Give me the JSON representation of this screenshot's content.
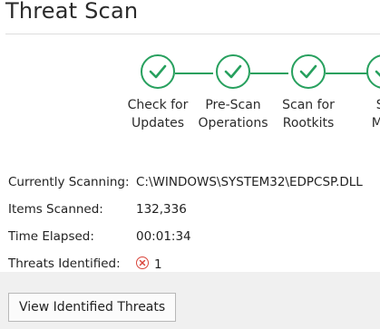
{
  "header": {
    "title": "Threat Scan"
  },
  "stepper": {
    "steps": [
      {
        "label": "Check for\nUpdates",
        "state": "complete",
        "icon": "check-icon"
      },
      {
        "label": "Pre-Scan\nOperations",
        "state": "complete",
        "icon": "check-icon"
      },
      {
        "label": "Scan for\nRootkits",
        "state": "complete",
        "icon": "check-icon"
      },
      {
        "label": "Sc\nMer",
        "state": "complete",
        "icon": "check-icon"
      }
    ],
    "color": "#27a05e"
  },
  "details": {
    "currently_scanning_label": "Currently Scanning:",
    "currently_scanning_value": "C:\\WINDOWS\\SYSTEM32\\EDPCSP.DLL",
    "items_scanned_label": "Items Scanned:",
    "items_scanned_value": "132,336",
    "time_elapsed_label": "Time Elapsed:",
    "time_elapsed_value": "00:01:34",
    "threats_identified_label": "Threats Identified:",
    "threats_identified_value": "1",
    "threat_icon": "error-x-icon",
    "threat_color": "#d9453b"
  },
  "footer": {
    "view_threats_label": "View Identified Threats"
  }
}
